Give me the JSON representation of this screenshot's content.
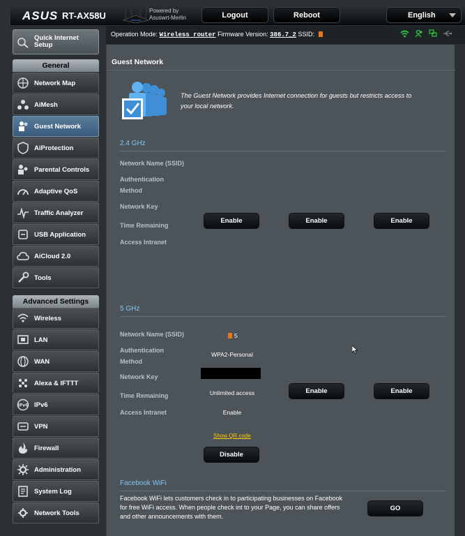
{
  "header": {
    "brand": "ASUS",
    "model": "RT-AX58U",
    "powered_by": "Powered by",
    "powered_by_name": "Asuswrt-Merlin",
    "logout_label": "Logout",
    "reboot_label": "Reboot",
    "language": "English"
  },
  "status": {
    "op_mode_label": "Operation Mode:",
    "op_mode_value": "Wireless router",
    "fw_label": "Firmware Version:",
    "fw_value": "386.7_2",
    "ssid_label": "SSID:"
  },
  "sidebar": {
    "quick_setup": "Quick Internet Setup",
    "general_title": "General",
    "general_items": [
      {
        "label": "Network Map",
        "icon": "network-map-icon"
      },
      {
        "label": "AiMesh",
        "icon": "aimesh-icon"
      },
      {
        "label": "Guest Network",
        "icon": "guest-network-icon",
        "active": true
      },
      {
        "label": "AiProtection",
        "icon": "aiprotection-icon"
      },
      {
        "label": "Parental Controls",
        "icon": "parental-controls-icon"
      },
      {
        "label": "Adaptive QoS",
        "icon": "adaptive-qos-icon"
      },
      {
        "label": "Traffic Analyzer",
        "icon": "traffic-analyzer-icon"
      },
      {
        "label": "USB Application",
        "icon": "usb-application-icon"
      },
      {
        "label": "AiCloud 2.0",
        "icon": "aicloud-icon"
      },
      {
        "label": "Tools",
        "icon": "tools-icon"
      }
    ],
    "advanced_title": "Advanced Settings",
    "advanced_items": [
      {
        "label": "Wireless",
        "icon": "wireless-icon"
      },
      {
        "label": "LAN",
        "icon": "lan-icon"
      },
      {
        "label": "WAN",
        "icon": "wan-icon"
      },
      {
        "label": "Alexa & IFTTT",
        "icon": "alexa-icon"
      },
      {
        "label": "IPv6",
        "icon": "ipv6-icon"
      },
      {
        "label": "VPN",
        "icon": "vpn-icon"
      },
      {
        "label": "Firewall",
        "icon": "firewall-icon"
      },
      {
        "label": "Administration",
        "icon": "administration-icon"
      },
      {
        "label": "System Log",
        "icon": "system-log-icon"
      },
      {
        "label": "Network Tools",
        "icon": "network-tools-icon"
      }
    ]
  },
  "main": {
    "title": "Guest Network",
    "intro": "The Guest Network provides Internet connection for guests but restricts access to your local network.",
    "labels": {
      "ssid": "Network Name (SSID)",
      "auth": "Authentication Method",
      "key": "Network Key",
      "time": "Time Remaining",
      "intranet": "Access Intranet"
    },
    "band24": {
      "title": "2.4 GHz",
      "buttons": [
        "Enable",
        "Enable",
        "Enable"
      ]
    },
    "band5": {
      "title": "5 GHz",
      "slot1": {
        "ssid": "5",
        "auth": "WPA2-Personal",
        "time": "Unlimited access",
        "intranet": "Enable",
        "qr_link": "Show QR code",
        "button": "Disable"
      },
      "buttons": [
        "Enable",
        "Enable"
      ]
    },
    "facebook": {
      "title": "Facebook WiFi",
      "text": "Facebook WiFi lets customers check in to participating businesses on Facebook for free WiFi access. When people check int to your Page, you can share offers and other announcements with them.",
      "go_label": "GO"
    }
  },
  "colors": {
    "accent_blue": "#7ec6f3",
    "active_menu": "#4a6d8c",
    "panel": "#4c5459",
    "link_yellow": "#ffcc00"
  }
}
